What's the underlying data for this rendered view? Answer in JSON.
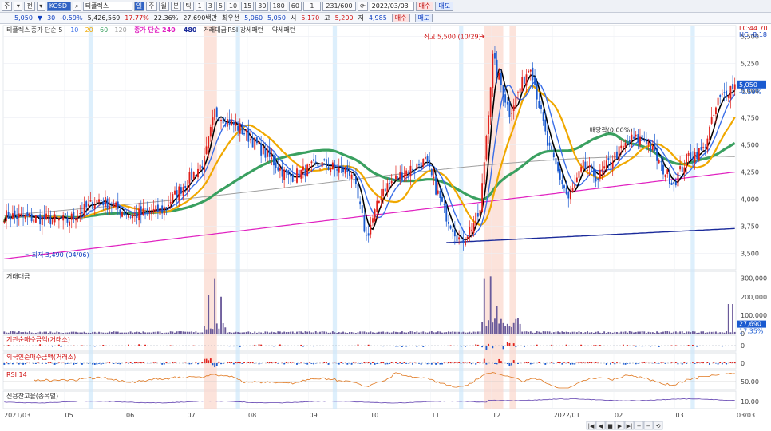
{
  "toolbar": {
    "items": [
      "주",
      "▾",
      "전",
      "▾"
    ],
    "stock_code": "KOSD",
    "stock_name": "티플렉스",
    "period_buttons": [
      "일",
      "주",
      "월",
      "분",
      "틱",
      "1",
      "3",
      "5",
      "10",
      "15",
      "30",
      "180",
      "60",
      "1"
    ],
    "count": "231/600",
    "date": "2022/03/03",
    "buy_label": "매수",
    "sell_label": "매도"
  },
  "quote": {
    "price": "5,050",
    "change": "30",
    "change_pct": "-0.59%",
    "volume": "5,426,569",
    "vol_ratio": "17.77%",
    "turnover": "22.36%",
    "amount": "27,690백만",
    "best_ask_label": "최우선",
    "best_ask": "5,060",
    "best_bid": "5,050",
    "open_label": "시",
    "open": "5,170",
    "high_label": "고",
    "high": "5,200",
    "low_label": "저",
    "low": "4,985"
  },
  "colors": {
    "up": "#e0201a",
    "down": "#1a5ad0",
    "ma5": "#000000",
    "ma10": "#3a6ee8",
    "ma20": "#f0a800",
    "ma60": "#3aa060",
    "ma120": "#a0a0a0",
    "ma240": "#e020c0",
    "ma480": "#1a2a9a",
    "highlight": "#fbd7cc",
    "highlight_blue": "#cfe8fb"
  },
  "chart_data": [
    {
      "type": "candlestick",
      "legend": [
        "티플렉스",
        "종가 단순 5",
        "10",
        "20",
        "60",
        "120",
        "종가 단순 240",
        "480",
        "거래대금",
        "RSI 강세패턴",
        "약세패턴"
      ],
      "corner_labels": [
        "LC:44.70",
        "HC:-8.18"
      ],
      "ylim": [
        3350,
        5600
      ],
      "y_ticks": [
        3500,
        3750,
        4000,
        4250,
        4500,
        4750,
        5000,
        5250,
        5500
      ],
      "y_tick_labels": [
        "3,500",
        "3,750",
        "4,000",
        "4,250",
        "4,500",
        "4,750",
        "5,000",
        "5,250",
        "5,500"
      ],
      "x_ticks": [
        "2021/03",
        "05",
        "06",
        "07",
        "08",
        "09",
        "10",
        "11",
        "12",
        "2022/01",
        "02",
        "03",
        "03/03"
      ],
      "last_price_label": "5,050",
      "last_change_label": "-0.59%",
      "annotations": [
        "최고 5,500 (10/29)",
        "최저 3,490 (04/06)",
        "배당락(0.00%)"
      ],
      "anchor_days": [
        0,
        30,
        45,
        60,
        75,
        95,
        100,
        112,
        120,
        135,
        150,
        165,
        172,
        180,
        190,
        200,
        210,
        217,
        222,
        226,
        232,
        240,
        250,
        258,
        268,
        275,
        282,
        290,
        298,
        305,
        312,
        318,
        325,
        332,
        339,
        346
      ],
      "anchor_closes": [
        3850,
        3800,
        4000,
        3850,
        3900,
        4350,
        4800,
        4650,
        4500,
        4200,
        4320,
        4250,
        3650,
        4100,
        4250,
        4350,
        3850,
        3600,
        3750,
        3880,
        5300,
        4800,
        5250,
        4500,
        4000,
        4300,
        4200,
        4400,
        4550,
        4550,
        4300,
        4150,
        4400,
        4450,
        4900,
        5050
      ],
      "ma_labels": [
        "종가 단순 5",
        "10",
        "20",
        "60",
        "120",
        "종가 단순 240",
        "480"
      ]
    },
    {
      "type": "bar",
      "title": "거래대금",
      "y_tick_labels": [
        "300,000",
        "200,000",
        "100,000",
        "0"
      ],
      "ylim": [
        0,
        320000
      ],
      "last_value_label": "27,690",
      "last_value_pct": "17.35%",
      "peaks": [
        {
          "day": 97,
          "value": 210000
        },
        {
          "day": 100,
          "value": 300000
        },
        {
          "day": 103,
          "value": 200000
        },
        {
          "day": 228,
          "value": 300000
        },
        {
          "day": 231,
          "value": 310000
        },
        {
          "day": 234,
          "value": 150000
        },
        {
          "day": 344,
          "value": 160000
        },
        {
          "day": 346,
          "value": 160000
        }
      ]
    },
    {
      "type": "bar",
      "title": "기관순매수금액(거래소)",
      "y_tick_labels": [
        "0"
      ]
    },
    {
      "type": "bar",
      "title": "외국인순매수금액(거래소)",
      "y_tick_labels": [
        "0"
      ]
    },
    {
      "type": "line",
      "title": "RSI 14",
      "y_tick_labels": [
        "50.00"
      ]
    },
    {
      "type": "line",
      "title": "신용잔고율(종목별)",
      "y_tick_labels": [
        "10.00"
      ]
    }
  ],
  "nav": {
    "buttons": [
      "|◀",
      "◀",
      "■",
      "▶",
      "▶|",
      "+",
      "−",
      "⟲"
    ]
  }
}
